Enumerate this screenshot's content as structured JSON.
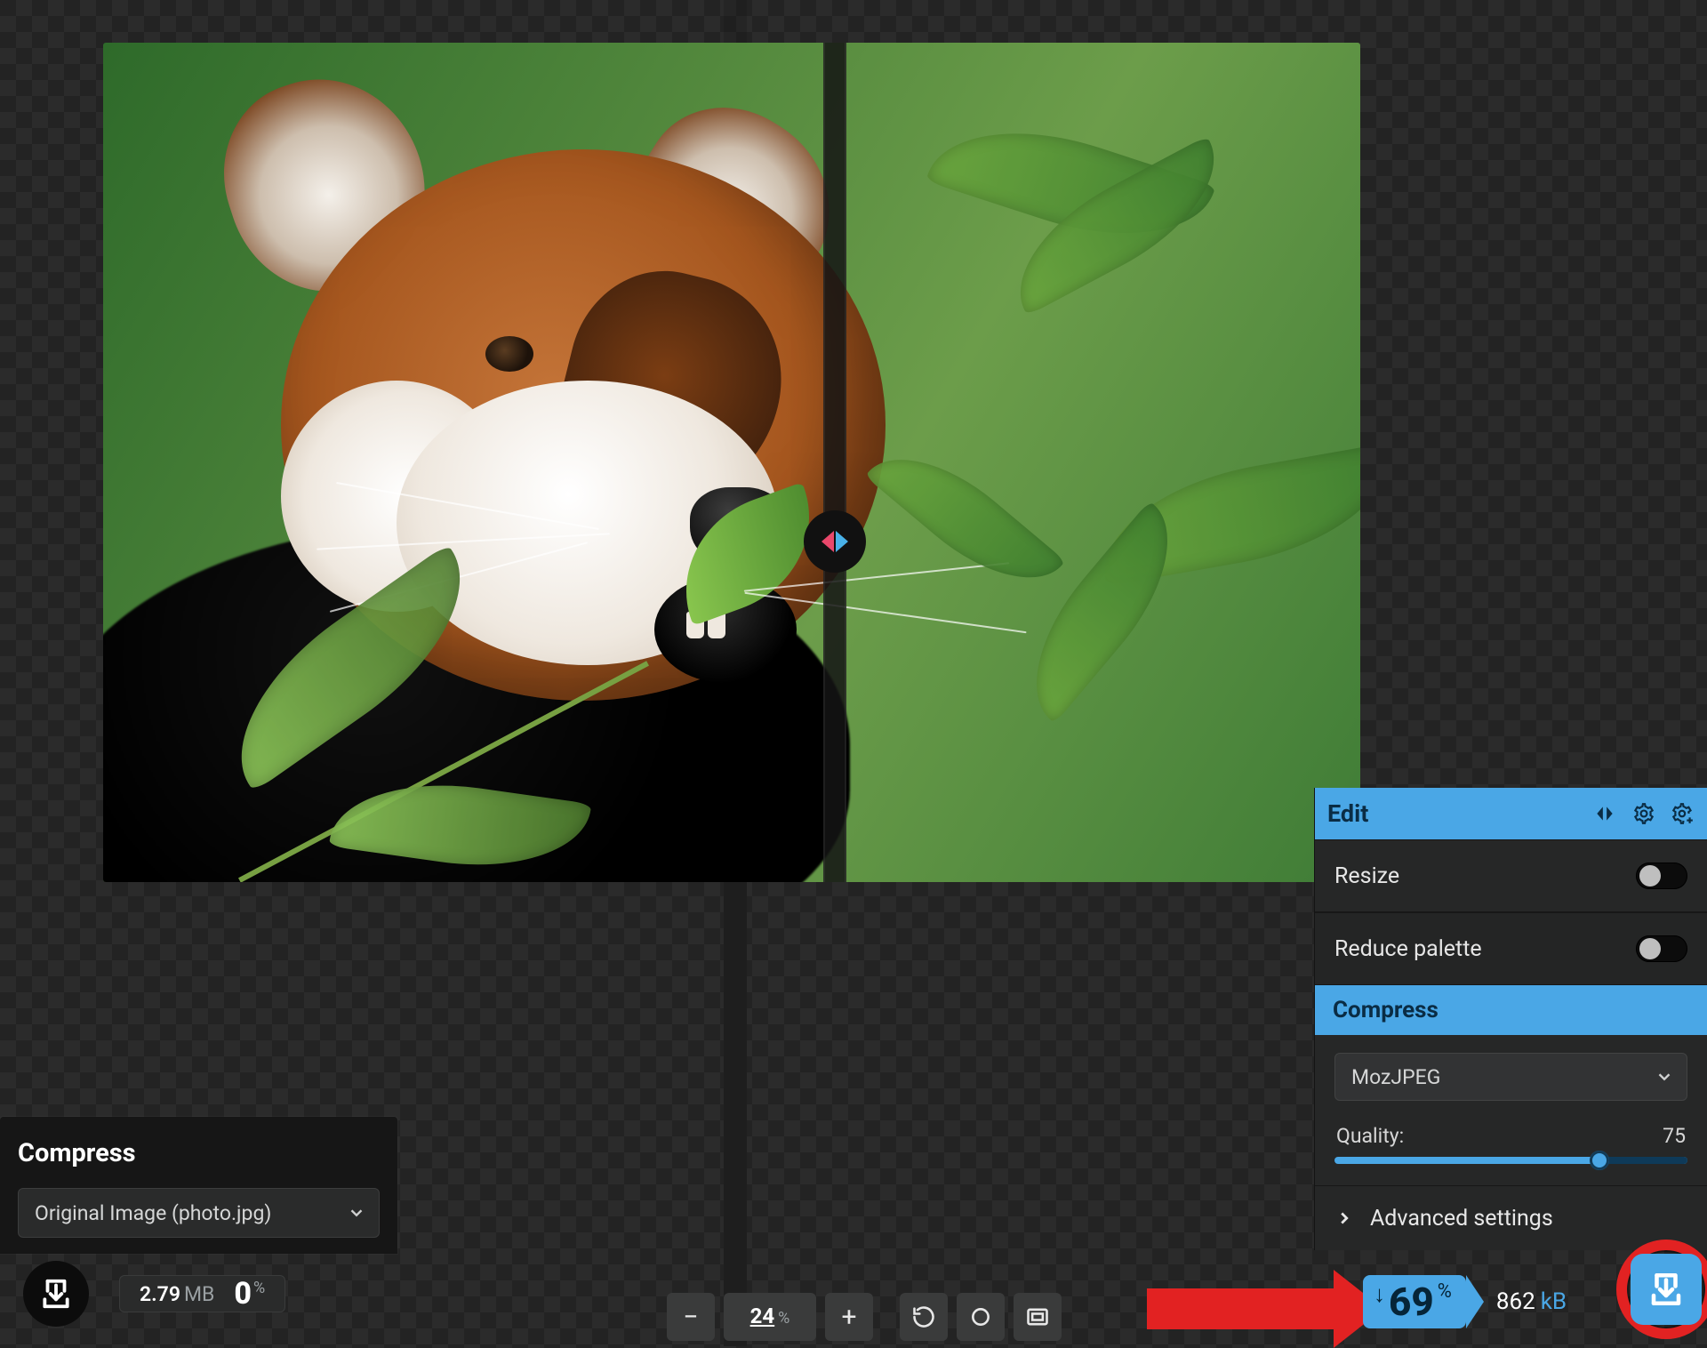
{
  "preview": {
    "subject": "red-panda-in-bamboo"
  },
  "left": {
    "section_title": "Compress",
    "source_select": "Original Image (photo.jpg)",
    "size_value": "2.79",
    "size_unit": "MB",
    "change_value": "0",
    "change_unit": "%"
  },
  "zoom": {
    "value": "24",
    "unit": "%",
    "minus": "−",
    "plus": "+"
  },
  "edit": {
    "title": "Edit",
    "resize_label": "Resize",
    "palette_label": "Reduce palette",
    "section_title": "Compress",
    "codec": "MozJPEG",
    "quality_label": "Quality:",
    "quality_value": "75",
    "advanced_label": "Advanced settings"
  },
  "result": {
    "savings_value": "69",
    "savings_unit": "%",
    "size_value": "862",
    "size_unit": "kB"
  },
  "icons": {
    "compare": "compare-icon",
    "gear": "gear-icon",
    "gear_plus": "gear-plus-icon",
    "download": "download-icon",
    "rotate": "rotate-icon",
    "circle": "circle-icon",
    "fit": "fit-screen-icon",
    "chevron_down": "chevron-down-icon",
    "chevron_right": "chevron-right-icon"
  }
}
